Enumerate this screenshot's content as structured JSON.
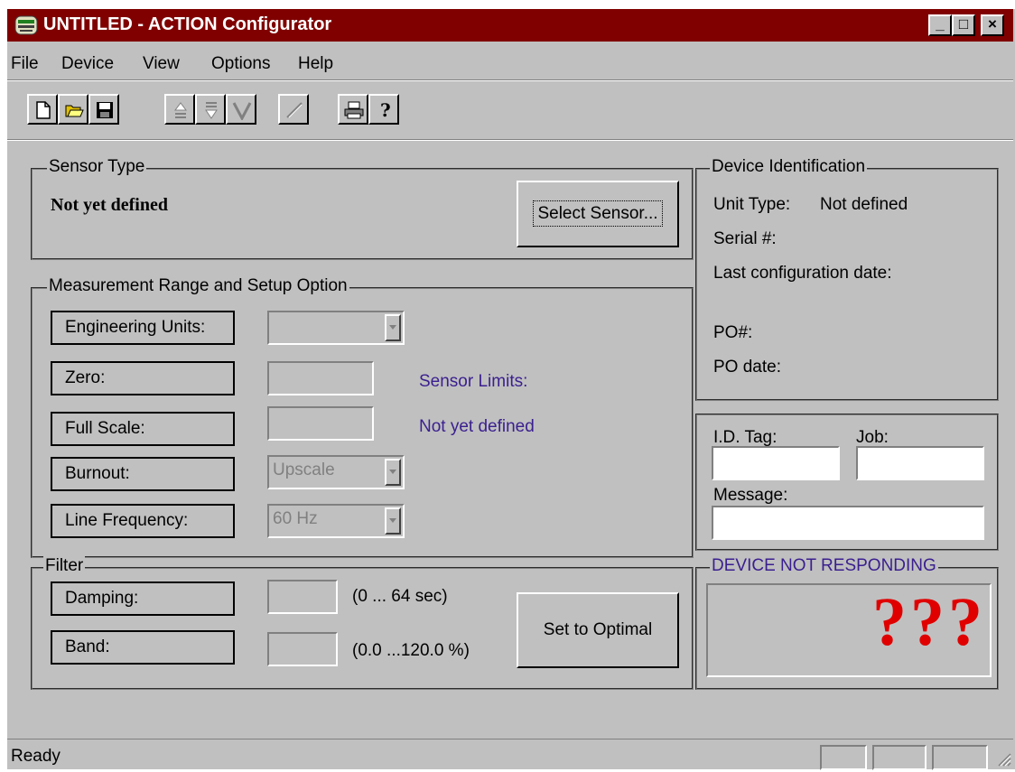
{
  "window": {
    "title": "UNTITLED - ACTION Configurator",
    "controls": {
      "minimize": "_",
      "maximize": "□",
      "close": "×"
    }
  },
  "menu": {
    "items": [
      "File",
      "Device",
      "View",
      "Options",
      "Help"
    ]
  },
  "toolbar": {
    "icons": [
      "new-icon",
      "open-icon",
      "save-icon",
      "upload-icon",
      "download-icon",
      "verify-icon",
      "probe-icon",
      "print-icon",
      "help-icon"
    ]
  },
  "sensor_type": {
    "legend": "Sensor Type",
    "value": "Not yet defined",
    "select_button": "Select Sensor..."
  },
  "measurement": {
    "legend": "Measurement Range and Setup Option",
    "engineering_units_label": "Engineering Units:",
    "zero_label": "Zero:",
    "full_scale_label": "Full Scale:",
    "burnout_label": "Burnout:",
    "burnout_value": "Upscale",
    "line_frequency_label": "Line Frequency:",
    "line_frequency_value": "60 Hz",
    "sensor_limits_label": "Sensor Limits:",
    "sensor_limits_value": "Not yet defined"
  },
  "filter": {
    "legend": "Filter",
    "damping_label": "Damping:",
    "damping_range": "(0 ... 64 sec)",
    "band_label": "Band:",
    "band_range": "(0.0 ...120.0 %)",
    "optimal_button": "Set to Optimal"
  },
  "device_id": {
    "legend": "Device Identification",
    "unit_type_label": "Unit Type:",
    "unit_type_value": "Not defined",
    "serial_label": "Serial #:",
    "last_config_label": "Last configuration date:",
    "po_label": "PO#:",
    "po_date_label": "PO date:"
  },
  "tags": {
    "id_tag_label": "I.D. Tag:",
    "job_label": "Job:",
    "message_label": "Message:"
  },
  "device_status": {
    "legend": "DEVICE NOT RESPONDING",
    "indicator": "???"
  },
  "statusbar": {
    "text": "Ready"
  },
  "colors": {
    "titlebar": "#800000",
    "face": "#c0c0c0",
    "accent_text": "#3a1f8f",
    "question_marks": "#e00000"
  }
}
